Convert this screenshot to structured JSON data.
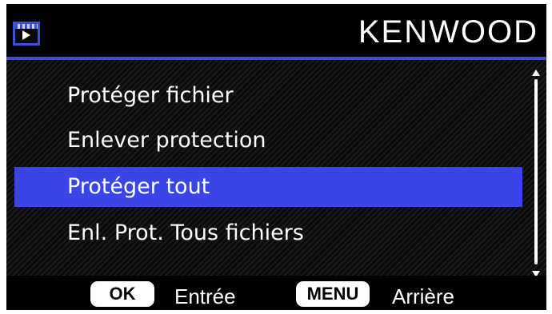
{
  "header": {
    "mode_icon": "playback-icon",
    "brand": "KENWOOD"
  },
  "menu": {
    "items": [
      {
        "label": "Protéger fichier",
        "selected": false
      },
      {
        "label": "Enlever protection",
        "selected": false
      },
      {
        "label": "Protéger tout",
        "selected": true
      },
      {
        "label": "Enl. Prot. Tous fichiers",
        "selected": false
      }
    ]
  },
  "footer": {
    "ok_key": "OK",
    "ok_action": "Entrée",
    "menu_key": "MENU",
    "menu_action": "Arrière"
  },
  "colors": {
    "accent": "#3a45e8",
    "background": "#0d0d0d",
    "text": "#ffffff"
  }
}
